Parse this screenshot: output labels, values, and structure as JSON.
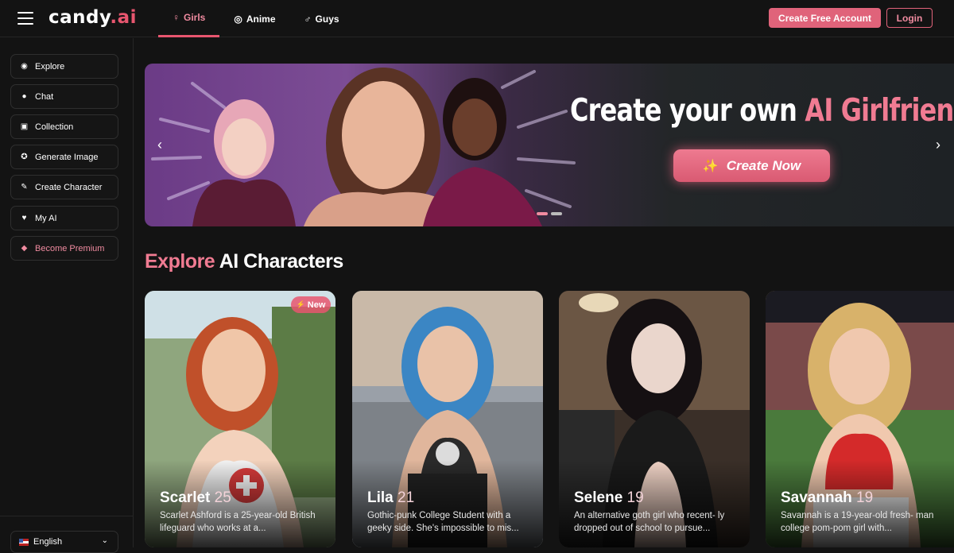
{
  "header": {
    "logo_text": "candy",
    "logo_suffix": ".ai",
    "tabs": [
      {
        "label": "Girls",
        "icon": "female-icon",
        "glyph": "♀"
      },
      {
        "label": "Anime",
        "icon": "anime-icon",
        "glyph": "◎"
      },
      {
        "label": "Guys",
        "icon": "male-icon",
        "glyph": "♂"
      }
    ],
    "create_account_label": "Create Free Account",
    "login_label": "Login"
  },
  "sidebar": {
    "items": [
      {
        "label": "Explore",
        "icon": "compass-icon",
        "glyph": "◉"
      },
      {
        "label": "Chat",
        "icon": "chat-bubble-icon",
        "glyph": "●"
      },
      {
        "label": "Collection",
        "icon": "gallery-icon",
        "glyph": "▣"
      },
      {
        "label": "Generate Image",
        "icon": "image-generate-icon",
        "glyph": "✪"
      },
      {
        "label": "Create Character",
        "icon": "magic-wand-icon",
        "glyph": "✎"
      },
      {
        "label": "My AI",
        "icon": "heart-robot-icon",
        "glyph": "♥"
      },
      {
        "label": "Become Premium",
        "icon": "diamond-icon",
        "glyph": "◆"
      }
    ],
    "language": "English"
  },
  "banner": {
    "title_white": "Create your own ",
    "title_pink": "AI Girlfriend",
    "button_label": "Create Now"
  },
  "section": {
    "title_pink": "Explore",
    "title_white": " AI Characters"
  },
  "cards": [
    {
      "name": "Scarlet",
      "age": "25",
      "badge": "New",
      "desc": "Scarlet Ashford is a 25-year-old British lifeguard who works at a..."
    },
    {
      "name": "Lila",
      "age": "21",
      "badge": "",
      "desc": "Gothic-punk College Student with a geeky side. She's impossible to mis..."
    },
    {
      "name": "Selene",
      "age": "19",
      "badge": "",
      "desc": "An alternative goth girl who recent- ly dropped out of school to pursue..."
    },
    {
      "name": "Savannah",
      "age": "19",
      "badge": "",
      "desc": "Savannah is a 19-year-old fresh- man college pom-pom girl with..."
    }
  ],
  "colors": {
    "accent": "#e8566f",
    "accent_light": "#f07b92",
    "background": "#131313"
  }
}
